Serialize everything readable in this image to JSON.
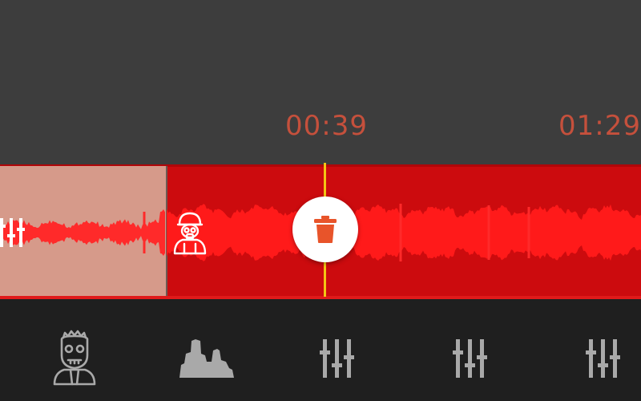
{
  "timeline": {
    "start_time": "00:39",
    "end_time": "01:29"
  },
  "colors": {
    "top_background": "#3d3d3d",
    "strip_background": "#cc0b0e",
    "waveform": "#ff1a1a",
    "trimmed_region": "#d69a8a",
    "playhead": "#f3c515",
    "delete_icon": "#e8542a",
    "time_text": "#c5503c",
    "toolbar_background": "#1f1f1f",
    "toolbar_icons": "#a9a9a9"
  },
  "icons": {
    "delete_button": "trash-icon",
    "clip_left": "mixer-icon",
    "clip_effect": "gasmask-person-icon",
    "toolbar": [
      "zombie-icon",
      "landscape-icon",
      "mixer-icon",
      "mixer-icon",
      "mixer-icon"
    ]
  }
}
